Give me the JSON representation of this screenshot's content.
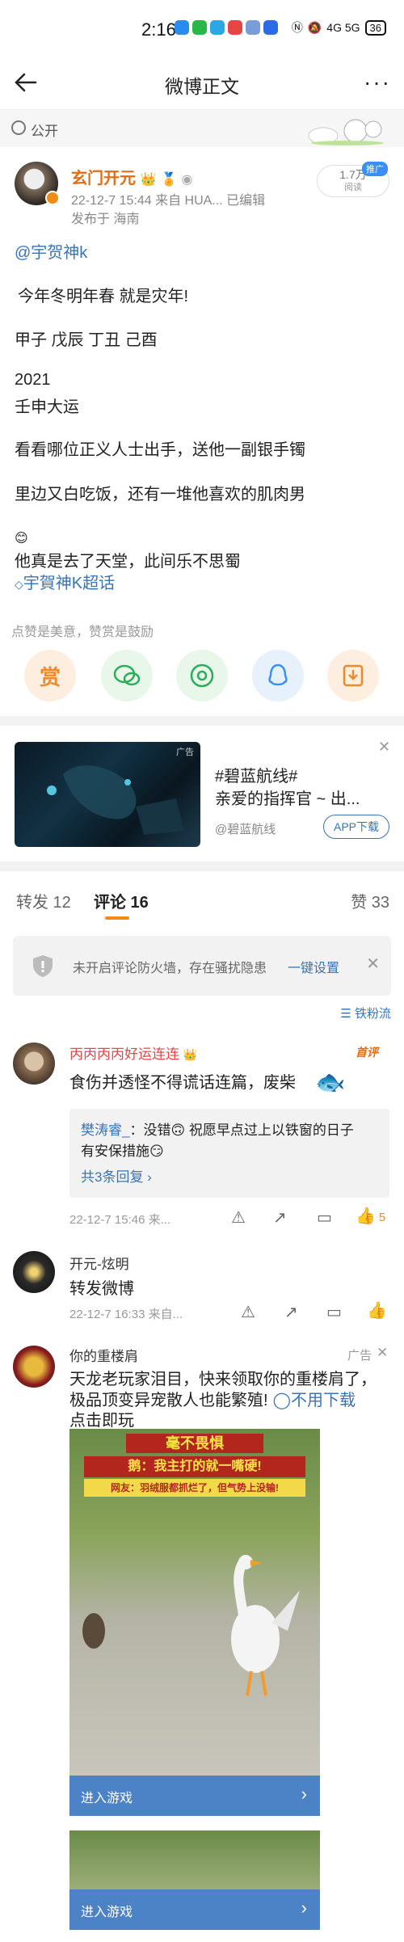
{
  "status": {
    "time": "2:16",
    "battery": "36",
    "signal": "4G 5G",
    "colors": [
      "#2b8cf0",
      "#29b74a",
      "#2aa7e4",
      "#2c6be6",
      "#e54545",
      "#7a9cd8"
    ]
  },
  "nav": {
    "title": "微博正文",
    "more": "···"
  },
  "visibility": {
    "label": "公开"
  },
  "author": {
    "name": "玄门开元",
    "time_device": "22-12-7 15:44  来自 HUA...   已编辑",
    "location": "发布于 海南",
    "reads_count": "1.7万",
    "reads_label": "阅读",
    "promo_tag": "推广"
  },
  "post": {
    "mention": "@宇贺神k",
    "lines": [
      "今年冬明年春 就是灾年!",
      "甲子 戊辰 丁丑 己酉",
      "2021",
      "壬申大运",
      "看看哪位正义人士出手，送他一副银手镯",
      "里边又白吃饭，还有一堆他喜欢的肌肉男",
      "他真是去了天堂，此间乐不思蜀"
    ],
    "topic": "宇賀神K超话"
  },
  "reward": {
    "hint": "点赞是美意，赞赏是鼓励",
    "reward_label": "赏"
  },
  "ad1": {
    "image_tag": "广告",
    "title": "#碧蓝航线#",
    "subtitle": "亲爱的指挥官 ~ 出...",
    "source": "@碧蓝航线",
    "download": "APP下载",
    "close": "✕"
  },
  "tabs": {
    "repost": "转发 12",
    "comment": "评论 16",
    "like": "赞 33"
  },
  "firewall": {
    "text": "未开启评论防火墙，存在骚扰隐患",
    "button": "一键设置",
    "close": "✕"
  },
  "fans_sort": "铁粉流",
  "comments": [
    {
      "name": "丙丙丙丙好运连连",
      "badge": "首评",
      "text": "食伤并透怪不得谎话连篇，废柴",
      "reply_author": "樊涛睿_",
      "reply_line1": "：没错🙃 祝愿早点过上以铁窗的日子",
      "reply_line2": "有安保措施😏",
      "reply_more": "共3条回复 ›",
      "meta": "22-12-7 15:46  来...",
      "likes": "5"
    },
    {
      "name": "开元-炫明",
      "text": "转发微博",
      "meta": "22-12-7 16:33  来自..."
    }
  ],
  "ad2": {
    "name": "你的重楼肩",
    "tag": "广告",
    "close": "✕",
    "line1": "天龙老玩家泪目，快来领取你的重楼肩了，",
    "line2_text": "极品顶变异宠散人也能繁殖!",
    "line2_link": "◯不用下载",
    "line3": "点击即玩",
    "banner1": "毫不畏惧",
    "banner2": "鹅：我主打的就一嘴硬!",
    "banner3": "网友：羽绒服都抓烂了，但气势上没输!",
    "cta": "进入游戏",
    "cta2": "进入游戏"
  }
}
